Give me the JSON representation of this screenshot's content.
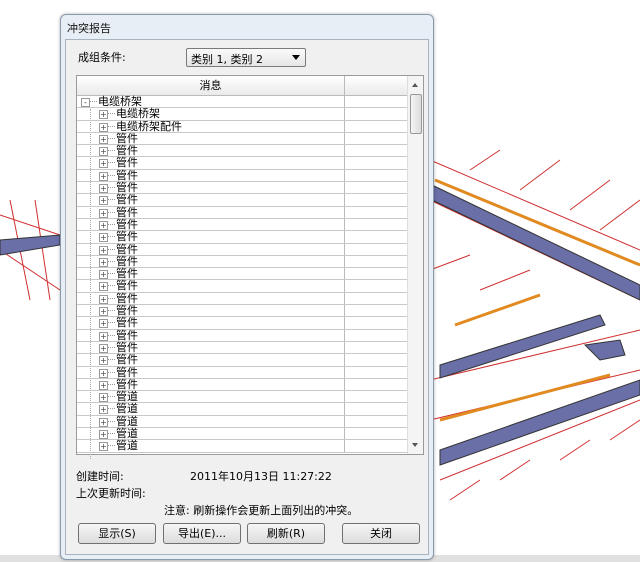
{
  "dialog": {
    "title": "冲突报告",
    "group_label": "成组条件:",
    "group_value": "类别 1, 类别 2",
    "column_header": "消息",
    "tree": {
      "root": "电缆桥架",
      "children": [
        "电缆桥架",
        "电缆桥架配件",
        "管件",
        "管件",
        "管件",
        "管件",
        "管件",
        "管件",
        "管件",
        "管件",
        "管件",
        "管件",
        "管件",
        "管件",
        "管件",
        "管件",
        "管件",
        "管件",
        "管件",
        "管件",
        "管件",
        "管件",
        "管件",
        "管道",
        "管道",
        "管道",
        "管道",
        "管道"
      ]
    },
    "created_label": "创建时间:",
    "created_value": "2011年10月13日  11:27:22",
    "updated_label": "上次更新时间:",
    "note": "注意: 刷新操作会更新上面列出的冲突。",
    "buttons": {
      "show": "显示(S)",
      "export": "导出(E)...",
      "refresh": "刷新(R)",
      "close": "关闭"
    }
  }
}
